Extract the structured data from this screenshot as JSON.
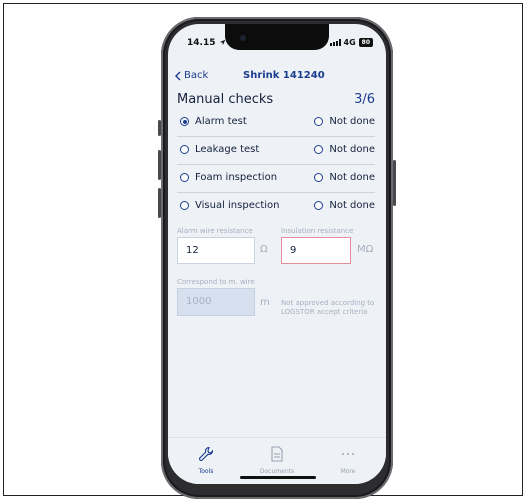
{
  "status_bar": {
    "time": "14.15",
    "network": "4G",
    "battery": "80"
  },
  "nav": {
    "back_label": "Back",
    "title": "Shrink 141240"
  },
  "page": {
    "heading": "Manual checks",
    "progress": "3/6"
  },
  "checks": [
    {
      "label": "Alarm test",
      "alt_label": "Not done",
      "selected": "left"
    },
    {
      "label": "Leakage test",
      "alt_label": "Not done",
      "selected": "none"
    },
    {
      "label": "Foam inspection",
      "alt_label": "Not done",
      "selected": "none"
    },
    {
      "label": "Visual inspection",
      "alt_label": "Not done",
      "selected": "none"
    }
  ],
  "alarm_wire": {
    "label": "Alarm wire resistance",
    "value": "12",
    "unit": "Ω"
  },
  "insulation": {
    "label": "Insulation resistance",
    "value": "9",
    "unit": "MΩ",
    "error": "Not approved according to LOGSTOR accept criteria"
  },
  "wire_length": {
    "label": "Correspond to m. wire",
    "value": "1000",
    "unit": "m"
  },
  "tabs": [
    {
      "label": "Tools",
      "icon": "wrench-icon",
      "active": true
    },
    {
      "label": "Documents",
      "icon": "document-icon",
      "active": false
    },
    {
      "label": "More",
      "icon": "more-icon",
      "active": false
    }
  ],
  "colors": {
    "primary": "#1a3d8f",
    "background": "#eef1f6",
    "error_border": "#e58b9a",
    "muted": "#a7b0c0"
  }
}
